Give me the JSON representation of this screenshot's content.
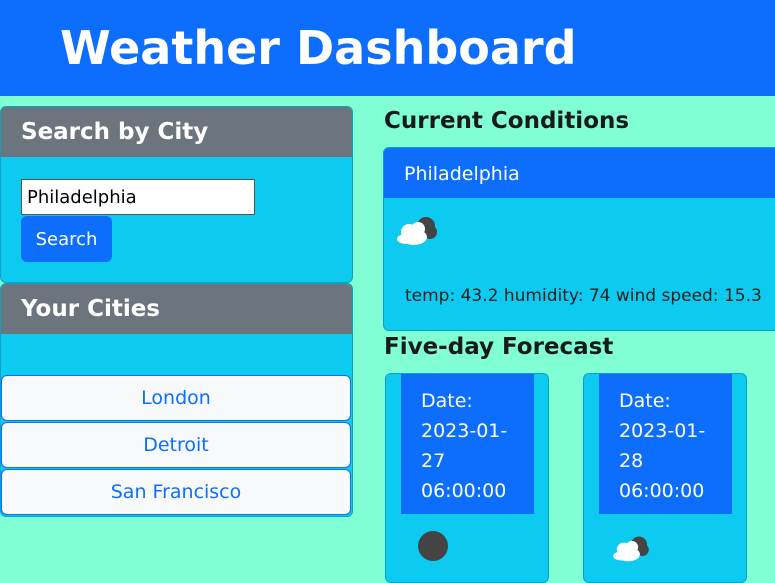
{
  "header": {
    "title": "Weather Dashboard"
  },
  "search": {
    "title": "Search by City",
    "input_value": "Philadelphia",
    "button_label": "Search"
  },
  "cities": {
    "title": "Your Cities",
    "items": [
      "London",
      "Detroit",
      "San Francisco"
    ]
  },
  "current": {
    "section_title": "Current Conditions",
    "city": "Philadelphia",
    "icon": "partly-cloudy-icon",
    "stats": "temp: 43.2 humidity: 74 wind speed: 15.3"
  },
  "forecast": {
    "section_title": "Five-day Forecast",
    "days": [
      {
        "date_label": "Date:",
        "date": "2023-01-27",
        "time": "06:00:00",
        "icon": "dark-circle-icon"
      },
      {
        "date_label": "Date:",
        "date": "2023-01-28",
        "time": "06:00:00",
        "icon": "partly-cloudy-icon"
      }
    ]
  },
  "colors": {
    "background": "#80ffd4",
    "primary": "#0d6efd",
    "info": "#0dcaf0",
    "secondary": "#6c757d"
  }
}
